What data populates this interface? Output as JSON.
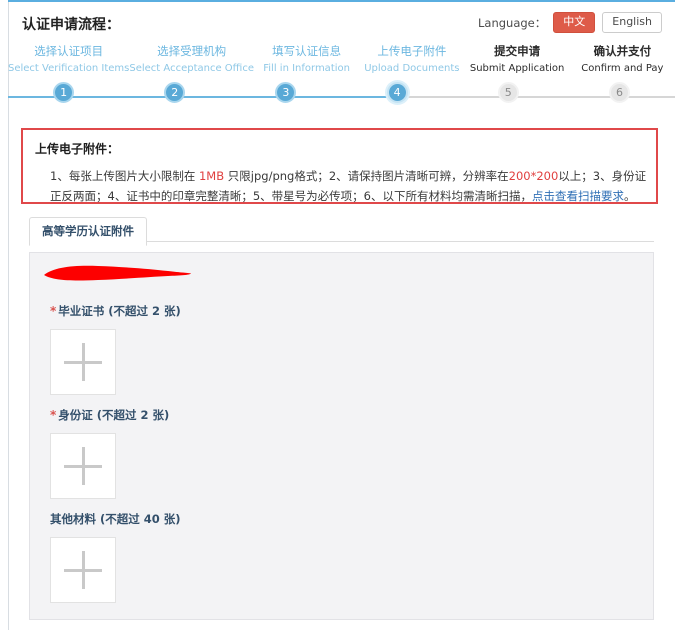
{
  "header": {
    "title": "认证申请流程：",
    "language_label": "Language：",
    "lang_cn": "中文",
    "lang_en": "English"
  },
  "stepper": {
    "steps": [
      {
        "num": "1",
        "cn": "选择认证项目",
        "en": "Select Verification Items",
        "state": "done"
      },
      {
        "num": "2",
        "cn": "选择受理机构",
        "en": "Select Acceptance Office",
        "state": "done"
      },
      {
        "num": "3",
        "cn": "填写认证信息",
        "en": "Fill in Information",
        "state": "done"
      },
      {
        "num": "4",
        "cn": "上传电子附件",
        "en": "Upload Documents",
        "state": "active"
      },
      {
        "num": "5",
        "cn": "提交申请",
        "en": "Submit Application",
        "state": "todo"
      },
      {
        "num": "6",
        "cn": "确认并支付",
        "en": "Confirm and Pay",
        "state": "todo"
      }
    ]
  },
  "notice": {
    "title": "上传电子附件：",
    "seg_1": "1、每张上传图片大小限制在 ",
    "seg_1mb": "1MB",
    "seg_2": " 只限jpg/png格式；2、请保持图片清晰可辨，分辨率在",
    "seg_200": "200*200",
    "seg_3": "以上；3、身份证正反两面；4、证书中的印章完整清晰；5、带星号为必传项；6、以下所有材料均需清晰扫描，",
    "link": "点击查看扫描要求",
    "seg_4": "。"
  },
  "tabs": [
    {
      "label": "高等学历认证附件",
      "active": true
    }
  ],
  "upload_groups": [
    {
      "required": true,
      "star": "*",
      "label": "毕业证书 (不超过 2 张)",
      "icon": "plus-icon"
    },
    {
      "required": true,
      "star": "*",
      "label": "身份证 (不超过 2 张)",
      "icon": "plus-icon"
    },
    {
      "required": false,
      "star": "",
      "label": "其他材料 (不超过 40 张)",
      "icon": "plus-icon"
    }
  ],
  "colors": {
    "accent_blue": "#59a9d6",
    "notice_border": "#e0484a",
    "notice_red_text": "#e0403f",
    "link_blue": "#2f6fb5",
    "lang_active": "#de5b49",
    "panel_bg": "#f3f3f5",
    "redaction_red": "#fd0000"
  }
}
